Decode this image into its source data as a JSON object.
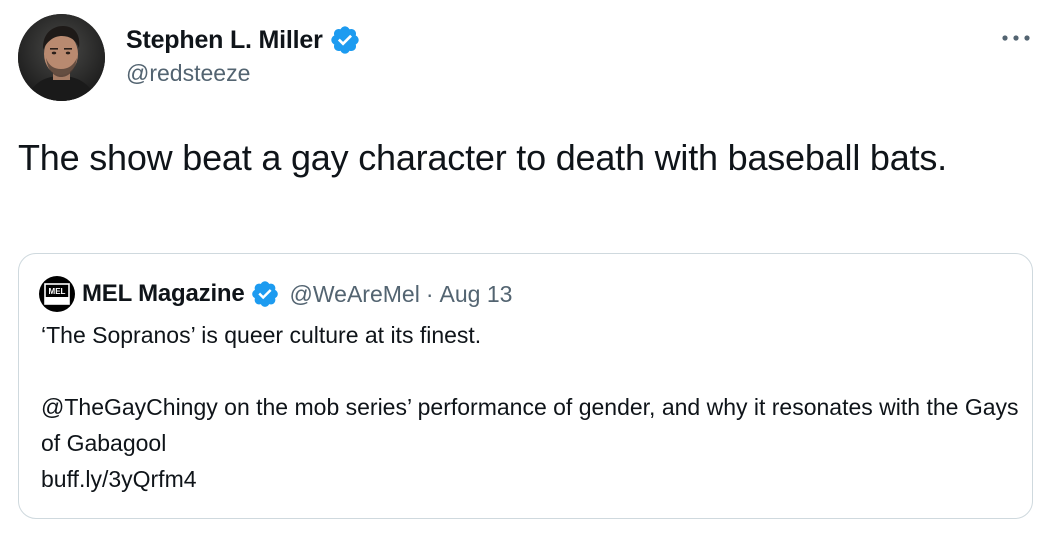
{
  "tweet": {
    "author": {
      "name": "Stephen L. Miller",
      "handle": "@redsteeze",
      "verified": true,
      "avatar_icon": "profile-photo"
    },
    "more_icon": "more-horizontal-icon",
    "text": "The show beat a gay character to death with baseball bats."
  },
  "quoted_tweet": {
    "author": {
      "name": "MEL Magazine",
      "handle": "@WeAreMel",
      "verified": true,
      "avatar_text": "MEL"
    },
    "separator": "·",
    "date": "Aug 13",
    "line1": "‘The Sopranos’ is queer culture at its finest.",
    "mention": "@TheGayChingy",
    "line2_rest": " on the mob series’ performance of gender, and why it resonates with the Gays of Gabagool",
    "link": "buff.ly/3yQrfm4"
  },
  "colors": {
    "verified_badge": "#1d9bf0",
    "text_primary": "#0f1419",
    "text_secondary": "#536471",
    "border": "#cfd9de"
  }
}
